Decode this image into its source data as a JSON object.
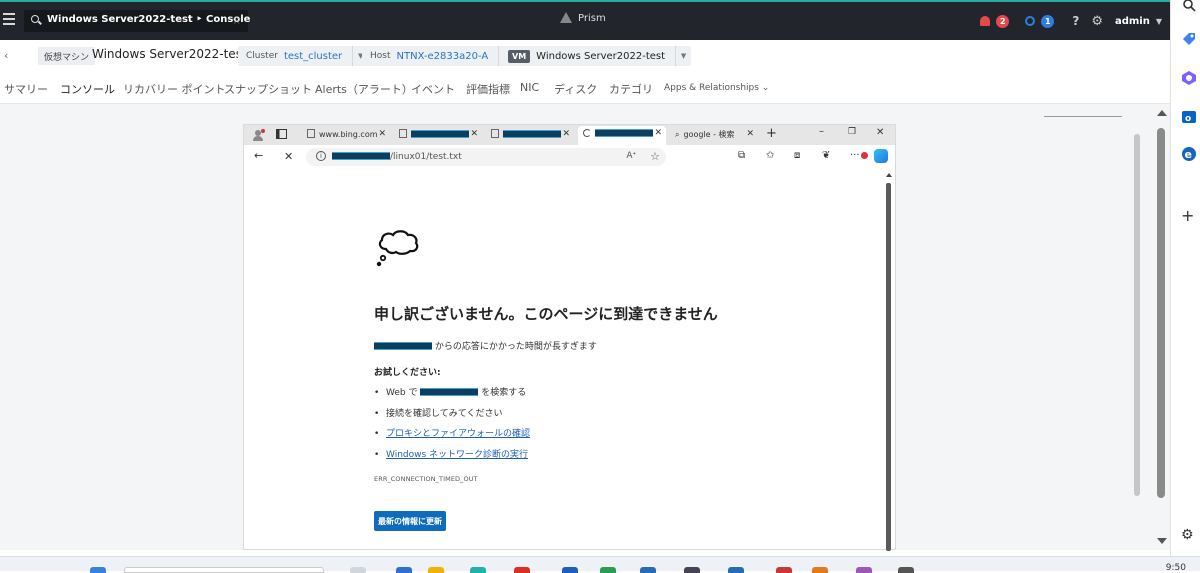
{
  "topbar": {
    "search_text": "Windows Server2022-test ‣ Console",
    "brand": "Prism",
    "alerts_count": "2",
    "tasks_count": "1",
    "help": "?",
    "user": "admin"
  },
  "breadcrumb": {
    "entity_type": "仮想マシン",
    "vm_name": "Windows Server2022-test",
    "cluster_label": "Cluster",
    "cluster_value": "test_cluster",
    "host_label": "Host",
    "host_value": "NTNX-e2833a20-A",
    "vm_label": "VM",
    "vm_value": "Windows Server2022-test"
  },
  "tabs": [
    {
      "label": "サマリー"
    },
    {
      "label": "コンソール"
    },
    {
      "label": "リカバリー ポイント"
    },
    {
      "label": "スナップショット"
    },
    {
      "label": "Alerts（アラート）"
    },
    {
      "label": "イベント"
    },
    {
      "label": "評価指標"
    },
    {
      "label": "NIC"
    },
    {
      "label": "ディスク"
    },
    {
      "label": "カテゴリ"
    },
    {
      "label": "Apps & Relationships ⌄"
    }
  ],
  "browser": {
    "tabs": [
      {
        "label": "www.bing.com"
      },
      {
        "label": "google - 検索"
      }
    ],
    "url_suffix": "/linux01/test.txt",
    "error": {
      "title": "申し訳ございません。このページに到達できません",
      "response_text": "からの応答にかかった時間が長すぎます",
      "try_heading": "お試しください:",
      "web_prefix": "Web で",
      "web_suffix": "を検索する",
      "check_connection": "接続を確認してみてください",
      "proxy_link": "プロキシとファイアウォールの確認",
      "diag_link": "Windows ネットワーク診断の実行",
      "error_code": "ERR_CONNECTION_TIMED_OUT",
      "refresh_button": "最新の情報に更新"
    }
  },
  "taskbar": {
    "clock": "9:50"
  },
  "colors": {
    "accent_teal": "#2aa9a0",
    "link_blue": "#2a71c8",
    "alert_red": "#e5484d",
    "refresh_blue": "#0f6cbd"
  }
}
